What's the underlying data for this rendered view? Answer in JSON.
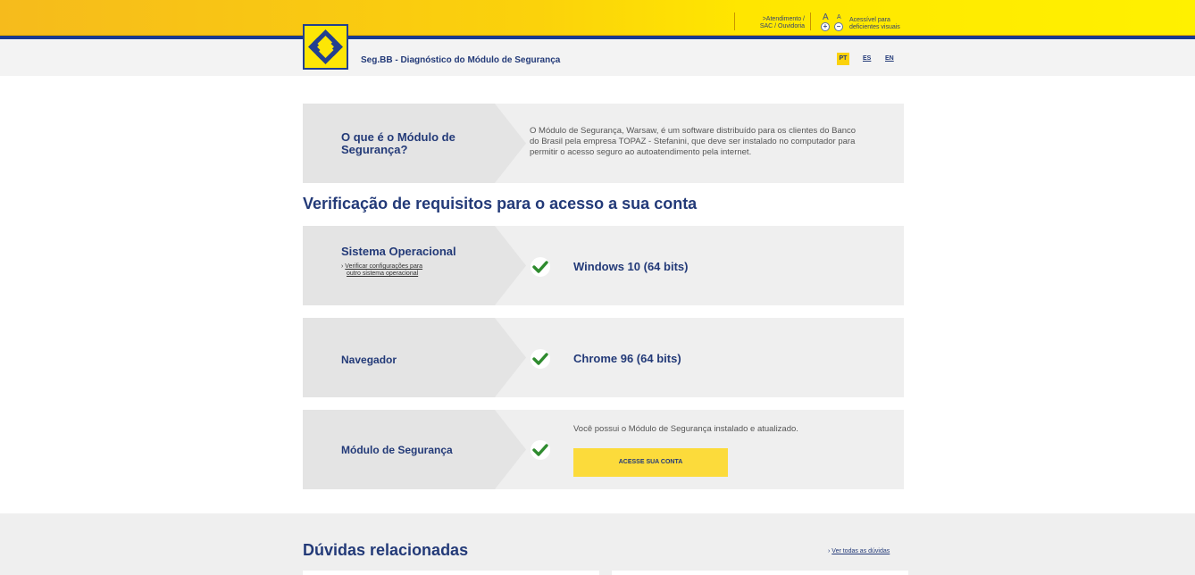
{
  "topbar": {
    "service_link": ">Atendimento / SAC / Ouvidoria",
    "service_link_line1": ">Atendimento /",
    "service_link_line2": "SAC / Ouvidoria",
    "font_increase": "A",
    "font_decrease": "A",
    "increase_symbol": "+",
    "decrease_symbol": "−",
    "accessibility_line1": "Acessível para",
    "accessibility_line2": "deficientes visuais"
  },
  "header": {
    "title": "Seg.BB - Diagnóstico do Módulo de Segurança",
    "languages": [
      "PT",
      "ES",
      "EN"
    ],
    "active_language": "PT"
  },
  "intro": {
    "question_line1": "O que é o Módulo de",
    "question_line2": "Segurança?",
    "description_line1": "O Módulo de Segurança, Warsaw, é um software distribuído para os clientes do Banco",
    "description_line2": "do Brasil pela empresa TOPAZ - Stefanini, que deve ser instalado no computador para",
    "description_line3": "permitir o acesso seguro ao autoatendimento pela internet."
  },
  "requirements": {
    "heading": "Verificação de requisitos para o acesso a sua conta",
    "os": {
      "label": "Sistema Operacional",
      "link_line1": "Verificar configurações para",
      "link_line2": "outro sistema operacional",
      "result": "Windows 10 (64 bits)"
    },
    "browser": {
      "label": "Navegador",
      "result": "Chrome 96 (64 bits)"
    },
    "module": {
      "label": "Módulo de Segurança",
      "result": "Você possui o Módulo de Segurança instalado e atualizado.",
      "button": "ACESSE SUA CONTA"
    }
  },
  "faq": {
    "title": "Dúvidas relacionadas",
    "see_all": "Ver todas as dúvidas"
  },
  "colors": {
    "brand_yellow": "#fbd20b",
    "brand_blue": "#233a78",
    "check_green": "#2e8b2e"
  },
  "icons": {
    "check": "check-icon",
    "logo": "bb-logo-icon",
    "link_arrow": "chevron-right-icon"
  }
}
